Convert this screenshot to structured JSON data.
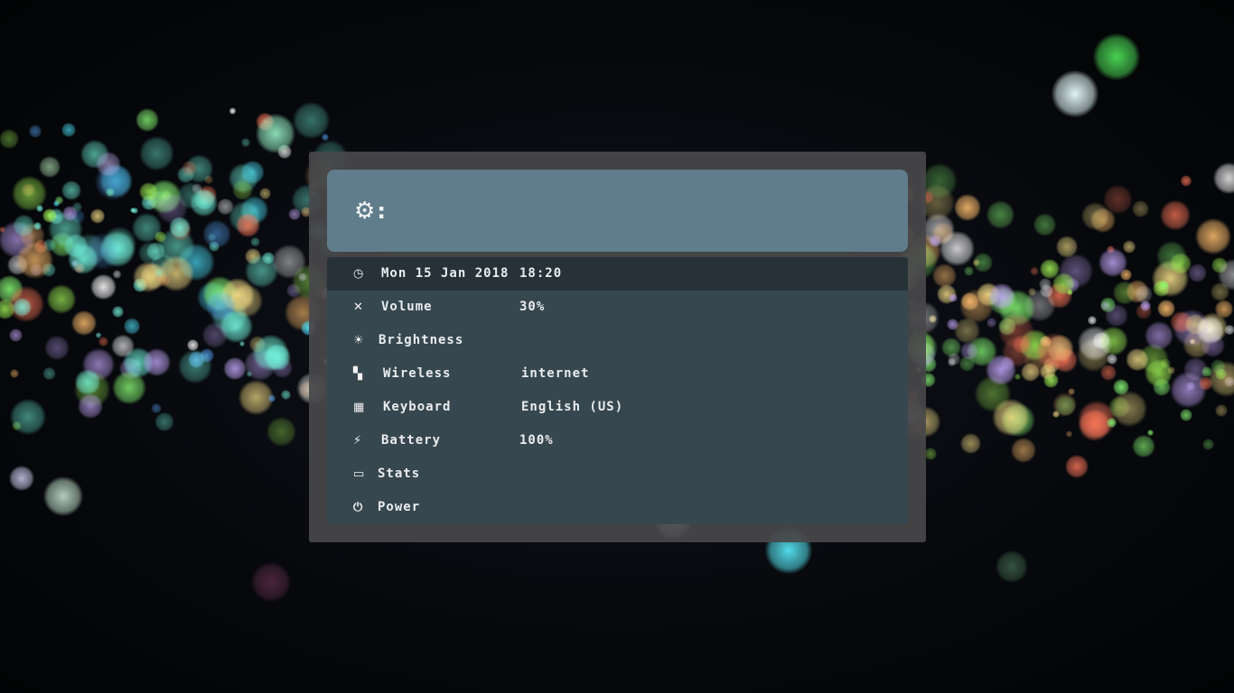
{
  "prompt": {
    "icon": "gear-icon",
    "glyph": "⚙",
    "suffix": ":"
  },
  "menu": {
    "items": [
      {
        "name": "datetime",
        "icon": "clock-icon",
        "glyph": "◷",
        "label": "Mon 15 Jan 2018",
        "value": "18:20",
        "selected": true
      },
      {
        "name": "volume",
        "icon": "volume-muted-icon",
        "glyph": "✕",
        "label": "Volume",
        "value": "30%"
      },
      {
        "name": "brightness",
        "icon": "sun-icon",
        "glyph": "☀",
        "label": "Brightness",
        "value": ""
      },
      {
        "name": "wireless",
        "icon": "signal-icon",
        "glyph": "▚",
        "label": "Wireless",
        "value": "internet"
      },
      {
        "name": "keyboard",
        "icon": "keyboard-icon",
        "glyph": "▦",
        "label": "Keyboard",
        "value": "English (US)"
      },
      {
        "name": "battery",
        "icon": "plug-icon",
        "glyph": "⚡",
        "label": "Battery",
        "value": "100%"
      },
      {
        "name": "stats",
        "icon": "laptop-icon",
        "glyph": "▭",
        "label": "Stats",
        "value": ""
      },
      {
        "name": "power",
        "icon": "power-icon",
        "glyph": "⏻",
        "label": "Power",
        "value": ""
      }
    ]
  },
  "colors": {
    "prompt_bg": "#607d8b",
    "list_bg": "#37474f",
    "selected_bg": "#263238",
    "frame_bg": "#48484a",
    "text": "#e9edef"
  }
}
